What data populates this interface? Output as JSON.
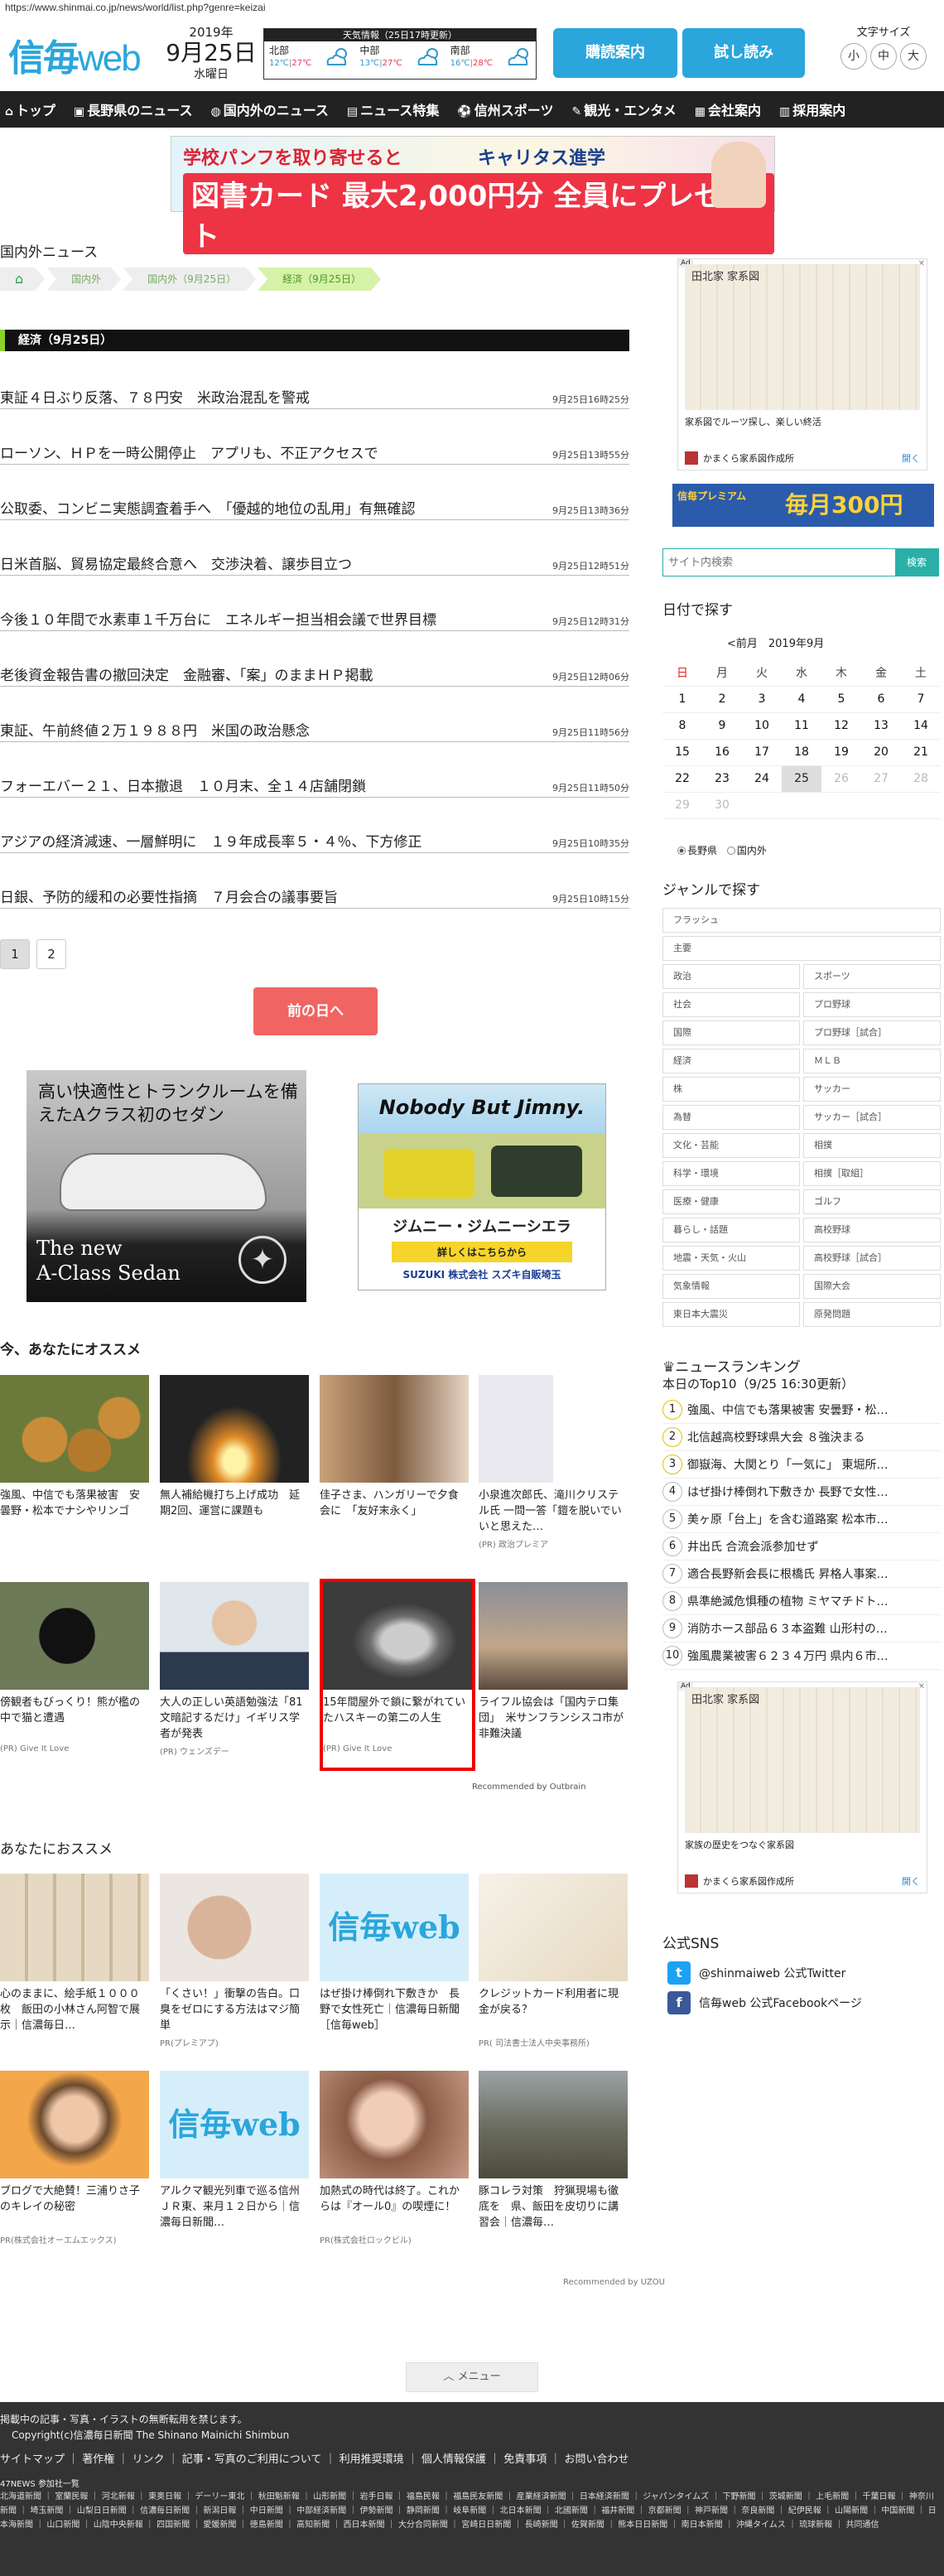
{
  "url": "https://www.shinmai.co.jp/news/world/list.php?genre=keizai",
  "header": {
    "logo_a": "信毎",
    "logo_b": "web",
    "year": "2019年",
    "date": "9月25日",
    "weekday": "水曜日",
    "weather_title": "天気情報（25日17時更新）",
    "regions": [
      {
        "name": "北部",
        "lo": "12℃",
        "hi": "27℃"
      },
      {
        "name": "中部",
        "lo": "13℃",
        "hi": "27℃"
      },
      {
        "name": "南部",
        "lo": "16℃",
        "hi": "28℃"
      }
    ],
    "btn_delivery": "購読案内",
    "btn_trial": "試し読み",
    "fontsize_label": "文字サイズ",
    "fontsize_small": "小",
    "fontsize_mid": "中",
    "fontsize_large": "大"
  },
  "nav": [
    "トップ",
    "長野県のニュース",
    "国内外のニュース",
    "ニュース特集",
    "信州スポーツ",
    "観光・エンタメ",
    "会社案内",
    "採用案内"
  ],
  "banner_top": {
    "line1": "学校パンフを取り寄せると",
    "line2": "キャリタス進学",
    "line3": "図書カード 最大2,000円分 全員にプレゼント"
  },
  "section_title": "国内外ニュース",
  "breadcrumb": [
    "国内外",
    "国内外（9月25日）",
    "経済（9月25日）"
  ],
  "category_bar": "経済（9月25日）",
  "news": [
    {
      "title": "東証４日ぶり反落、７８円安　米政治混乱を警戒",
      "time": "9月25日16時25分"
    },
    {
      "title": "ローソン、ＨＰを一時公開停止　アプリも、不正アクセスで",
      "time": "9月25日13時55分"
    },
    {
      "title": "公取委、コンビニ実態調査着手へ　「優越的地位の乱用」有無確認",
      "time": "9月25日13時36分"
    },
    {
      "title": "日米首脳、貿易協定最終合意へ　交渉決着、譲歩目立つ",
      "time": "9月25日12時51分"
    },
    {
      "title": "今後１０年間で水素車１千万台に　エネルギー担当相会議で世界目標",
      "time": "9月25日12時31分"
    },
    {
      "title": "老後資金報告書の撤回決定　金融審、「案」のままＨＰ掲載",
      "time": "9月25日12時06分"
    },
    {
      "title": "東証、午前終値２万１９８８円　米国の政治懸念",
      "time": "9月25日11時56分"
    },
    {
      "title": "フォーエバー２１、日本撤退　１０月末、全１４店舗閉鎖",
      "time": "9月25日11時50分"
    },
    {
      "title": "アジアの経済減速、一層鮮明に　１９年成長率５・４％、下方修正",
      "time": "9月25日10時35分"
    },
    {
      "title": "日銀、予防的緩和の必要性指摘　７月会合の議事要旨",
      "time": "9月25日10時15分"
    }
  ],
  "pages": [
    "1",
    "2"
  ],
  "prev_day": "前の日へ",
  "ad_merc": {
    "top": "高い快適性とトランクルームを備えたAクラス初のセダン",
    "bottom1": "The new",
    "bottom2": "A-Class Sedan"
  },
  "ad_jimny": {
    "title": "Nobody But Jimny.",
    "name": "ジムニー・ジムニーシエラ",
    "detail": "詳しくはこちらから",
    "sponsor": "SUZUKI 株式会社 スズキ自販埼玉"
  },
  "rec_title": "今、あなたにオススメ",
  "rec_cards": [
    {
      "cap": "強風、中信でも落果被害　安曇野・松本でナシやリンゴ",
      "src": ""
    },
    {
      "cap": "無人補給機打ち上げ成功　延期2回、運営に課題も",
      "src": ""
    },
    {
      "cap": "佳子さま、ハンガリーで夕食会に　「友好末永く」",
      "src": ""
    },
    {
      "cap": "小泉進次郎氏、滝川クリステル氏 一問一答「鎧を脱いでいいと思えた…",
      "src": "(PR) 政治プレミア"
    },
    {
      "cap": "傍観者もびっくり！熊が檻の中で猫と遭遇",
      "src": "(PR) Give It Love"
    },
    {
      "cap": "大人の正しい英語勉強法「81文暗記するだけ」イギリス学者が発表",
      "src": "(PR) ウェンズデー"
    },
    {
      "cap": "15年間屋外で鎖に繋がれていたハスキーの第二の人生",
      "src": "(PR) Give It Love"
    },
    {
      "cap": "ライフル協会は「国内テロ集団」　米サンフランシスコ市が非難決議",
      "src": ""
    }
  ],
  "outbrain": "Recommended by Outbrain",
  "rec2_title": "あなたにおススメ",
  "rec2_cards": [
    {
      "cap": "心のままに、絵手紙１０００枚　飯田の小林さん阿智で展示｜信濃毎日…",
      "src": ""
    },
    {
      "cap": "「くさい！」衝撃の告白。口臭をゼロにする方法はマジ簡単",
      "src": "PR(プレミアプ)"
    },
    {
      "cap": "はぜ掛け棒倒れ下敷きか　長野で女性死亡｜信濃毎日新聞［信毎web］",
      "src": ""
    },
    {
      "cap": "クレジットカード利用者に現金が戻る？",
      "src": "PR( 司法書士法人中央事務所)"
    },
    {
      "cap": "ブログで大絶賛！三浦りさ子のキレイの秘密",
      "src": "PR(株式会社オーエムエックス)"
    },
    {
      "cap": "アルクマ観光列車で巡る信州　ＪＲ東、来月１２日から｜信濃毎日新聞…",
      "src": ""
    },
    {
      "cap": "加熱式の時代は終了。これからは『オール0』の喫煙に！",
      "src": "PR(株式会社ロックビル)"
    },
    {
      "cap": "豚コレラ対策　狩猟現場も徹底を　県、飯田を皮切りに講習会｜信濃毎…",
      "src": ""
    }
  ],
  "uzou": "Recommended by UZOU",
  "menu_btn": "メニュー",
  "sidebar": {
    "ad1": {
      "title": "田北家 家系図",
      "cap": "家系図でルーツ探し、楽しい終活",
      "advertiser": "かまくら家系図作成所",
      "open": "開く"
    },
    "ad2": {
      "title": "田北家 家系図",
      "cap": "家族の歴史をつなぐ家系図",
      "advertiser": "かまくら家系図作成所",
      "open": "開く"
    },
    "banner": {
      "l": "信毎プレミアム",
      "r": "毎月300円"
    },
    "search_placeholder": "サイト内検索",
    "search_btn": "検索",
    "cal_title": "日付で探す",
    "cal_nav": "<前月　2019年9月",
    "cal_head": [
      "日",
      "月",
      "火",
      "水",
      "木",
      "金",
      "土"
    ],
    "cal_rows": [
      [
        "1",
        "2",
        "3",
        "4",
        "5",
        "6",
        "7"
      ],
      [
        "8",
        "9",
        "10",
        "11",
        "12",
        "13",
        "14"
      ],
      [
        "15",
        "16",
        "17",
        "18",
        "19",
        "20",
        "21"
      ],
      [
        "22",
        "23",
        "24",
        "25",
        "26",
        "27",
        "28"
      ],
      [
        "29",
        "30",
        "",
        "",
        "",
        "",
        ""
      ]
    ],
    "radio_a": "長野県",
    "radio_b": "国内外",
    "genre_title": "ジャンルで探す",
    "genre_full": [
      "フラッシュ",
      "主要"
    ],
    "genre_pairs": [
      [
        "政治",
        "スポーツ"
      ],
      [
        "社会",
        "プロ野球"
      ],
      [
        "国際",
        "プロ野球［試合］"
      ],
      [
        "経済",
        "ＭＬＢ"
      ],
      [
        "株",
        "サッカー"
      ],
      [
        "為替",
        "サッカー［試合］"
      ],
      [
        "文化・芸能",
        "相撲"
      ],
      [
        "科学・環境",
        "相撲［取組］"
      ],
      [
        "医療・健康",
        "ゴルフ"
      ],
      [
        "暮らし・話題",
        "高校野球"
      ],
      [
        "地震・天気・火山",
        "高校野球［試合］"
      ],
      [
        "気象情報",
        "国際大会"
      ],
      [
        "東日本大震災",
        "原発問題"
      ]
    ],
    "rank_title": "ニュースランキング",
    "rank_sub": "本日のTop10（9/25 16:30更新）",
    "rank": [
      "強風、中信でも落果被害 安曇野・松…",
      "北信越高校野球県大会 ８強決まる",
      "御嶽海、大関とり「一気に」 東堀所…",
      "はぜ掛け棒倒れ下敷きか 長野で女性…",
      "美ヶ原「台上」を含む道路案 松本市…",
      "井出氏 合流会派参加せず",
      "適合長野新会長に根橋氏 昇格人事案…",
      "県準絶滅危惧種の植物 ミヤマチドト…",
      "消防ホース部品６３本盗難 山形村の…",
      "強風農業被害６２３４万円 県内６市…"
    ],
    "sns_title": "公式SNS",
    "sns_tw": "@shinmaiweb 公式Twitter",
    "sns_fb": "信毎web 公式Facebookページ"
  },
  "footer": {
    "l1": "掲載中の記事・写真・イラストの無断転用を禁じます。",
    "l2": "Copyright(c)信濃毎日新聞 The Shinano Mainichi Shimbun",
    "links": "サイトマップ ｜ 著作権 ｜ リンク ｜ 記事・写真のご利用について ｜ 利用推奨環境 ｜ 個人情報保護 ｜ 免責事項 ｜ お問い合わせ",
    "members_title": "47NEWS 参加社一覧",
    "members": "北海道新聞 ｜ 室蘭民報 ｜ 河北新報 ｜ 東奥日報 ｜ デーリー東北 ｜ 秋田魁新報 ｜ 山形新聞 ｜ 岩手日報 ｜ 福島民報 ｜ 福島民友新聞 ｜ 産業経済新聞 ｜ 日本経済新聞 ｜ ジャパンタイムズ ｜ 下野新聞 ｜ 茨城新聞 ｜ 上毛新聞 ｜ 千葉日報 ｜ 神奈川新聞 ｜ 埼玉新聞 ｜ 山梨日日新聞 ｜ 信濃毎日新聞 ｜ 新潟日報 ｜ 中日新聞 ｜ 中部経済新聞 ｜ 伊勢新聞 ｜ 静岡新聞 ｜ 岐阜新聞 ｜ 北日本新聞 ｜ 北國新聞 ｜ 福井新聞 ｜ 京都新聞 ｜ 神戸新聞 ｜ 奈良新聞 ｜ 紀伊民報 ｜ 山陽新聞 ｜ 中国新聞 ｜ 日本海新聞 ｜ 山口新聞 ｜ 山陰中央新報 ｜ 四国新聞 ｜ 愛媛新聞 ｜ 徳島新聞 ｜ 高知新聞 ｜ 西日本新聞 ｜ 大分合同新聞 ｜ 宮崎日日新聞 ｜ 長崎新聞 ｜ 佐賀新聞 ｜ 熊本日日新聞 ｜ 南日本新聞 ｜ 沖縄タイムス ｜ 琉球新報 ｜ 共同通信"
  }
}
